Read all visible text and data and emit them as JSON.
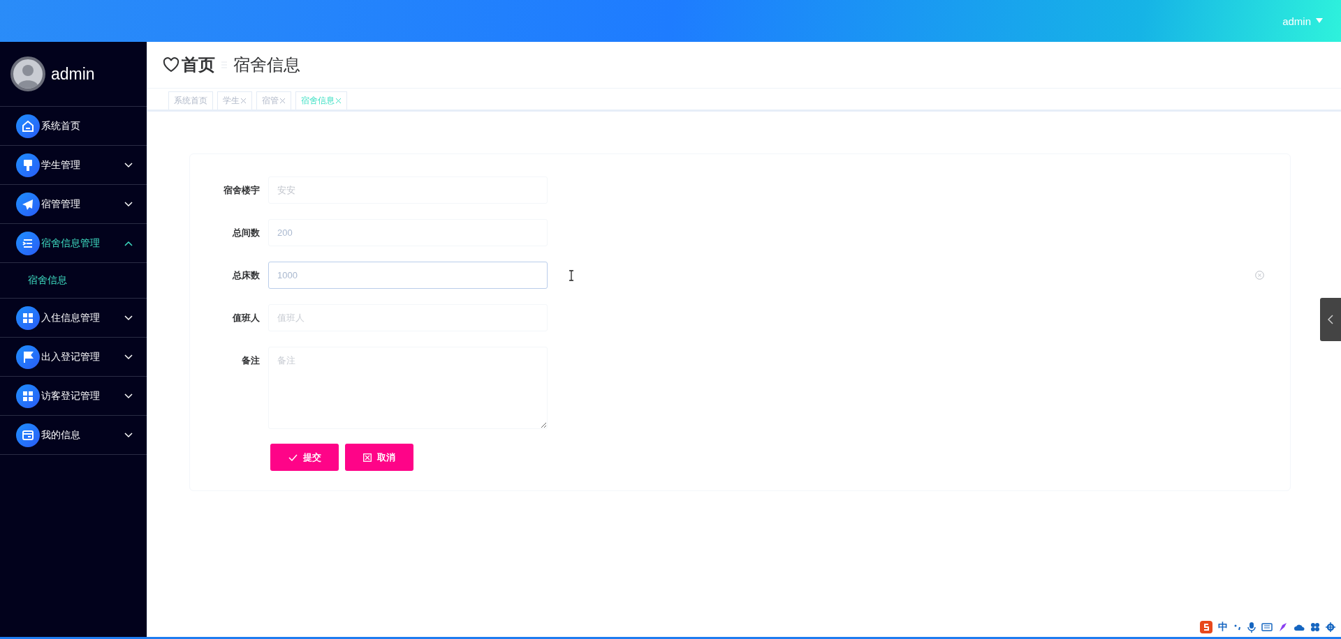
{
  "topbar": {
    "user": "admin"
  },
  "sidebar": {
    "user": "admin",
    "items": [
      {
        "label": "系统首页",
        "selected": false
      },
      {
        "label": "学生管理",
        "expanded": false,
        "selected": false
      },
      {
        "label": "宿管管理",
        "expanded": false,
        "selected": false
      },
      {
        "label": "宿舍信息管理",
        "expanded": true,
        "selected": true,
        "children": [
          {
            "label": "宿舍信息",
            "selected": true
          }
        ]
      },
      {
        "label": "入住信息管理",
        "expanded": false,
        "selected": false
      },
      {
        "label": "出入登记管理",
        "expanded": false,
        "selected": false
      },
      {
        "label": "访客登记管理",
        "expanded": false,
        "selected": false
      },
      {
        "label": "我的信息",
        "expanded": false,
        "selected": false
      }
    ]
  },
  "breadcrumb": {
    "home": "首页",
    "current": "宿舍信息"
  },
  "tabs": [
    {
      "label": "系统首页",
      "closable": false,
      "selected": false
    },
    {
      "label": "学生",
      "closable": true,
      "selected": false
    },
    {
      "label": "宿管",
      "closable": true,
      "selected": false
    },
    {
      "label": "宿舍信息",
      "closable": true,
      "selected": true
    }
  ],
  "form": {
    "fields": [
      {
        "kind": "readonly",
        "label": "宿舍楼宇",
        "value": "安安",
        "focused": false
      },
      {
        "kind": "input",
        "label": "总间数",
        "value": "200",
        "focused": false
      },
      {
        "kind": "input",
        "label": "总床数",
        "value": "1000",
        "focused": true
      },
      {
        "kind": "input",
        "label": "值班人",
        "placeholder": "值班人",
        "focused": false
      },
      {
        "kind": "textarea",
        "label": "备注",
        "placeholder": "备注"
      }
    ],
    "buttons": [
      {
        "kind": "submit",
        "label": "提交"
      },
      {
        "kind": "cancel",
        "label": "取消"
      }
    ]
  },
  "ime": {
    "mode": "中"
  }
}
